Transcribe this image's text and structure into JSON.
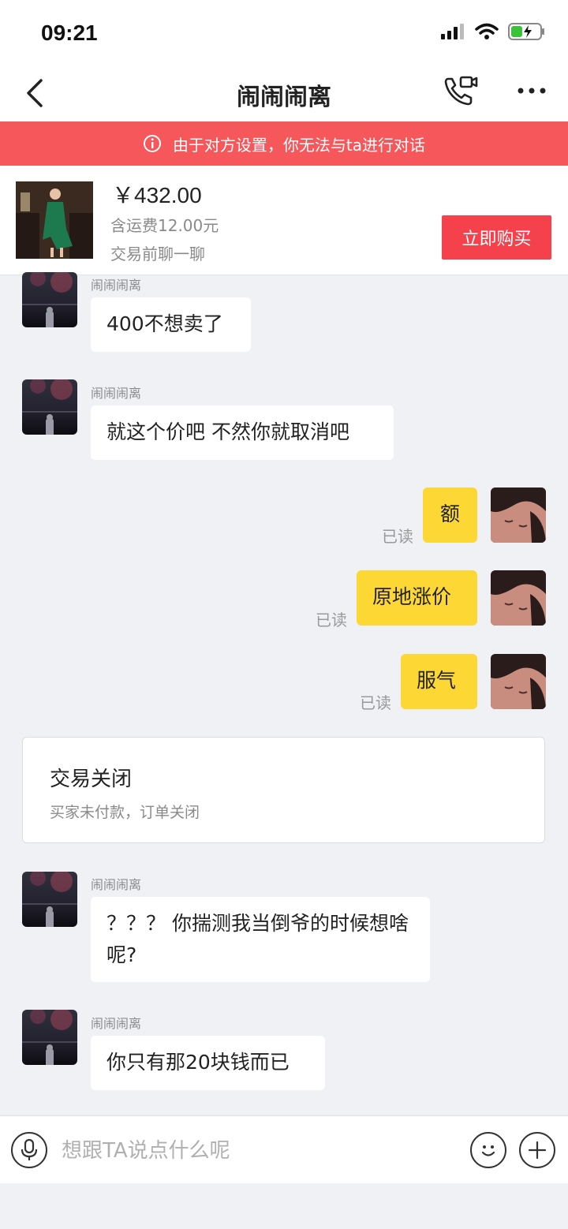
{
  "status_bar": {
    "time": "09:21",
    "icons": [
      "signal-icon",
      "wifi-icon",
      "battery-icon"
    ],
    "battery_color": "#3cc13b"
  },
  "nav": {
    "title": "闹闹闹离",
    "icons": [
      "back-icon",
      "phone-video-icon",
      "more-icon"
    ]
  },
  "banner": {
    "text": "由于对方设置，你无法与ta进行对话",
    "icon": "info-icon",
    "color": "#f5575a"
  },
  "product": {
    "price": "￥432.00",
    "shipping": "含运费12.00元",
    "chat_label": "交易前聊一聊",
    "buy_label": "立即购买",
    "buy_color": "#f5414b"
  },
  "messages": [
    {
      "from": "other",
      "name": "闹闹闹离",
      "text": "400不想卖了"
    },
    {
      "from": "other",
      "name": "闹闹闹离",
      "text": "就这个价吧 不然你就取消吧"
    },
    {
      "from": "self",
      "read": "已读",
      "text": "额"
    },
    {
      "from": "self",
      "read": "已读",
      "text": "原地涨价"
    },
    {
      "from": "self",
      "read": "已读",
      "text": "服气"
    },
    {
      "from": "other",
      "name": "闹闹闹离",
      "text": "？？？ 你揣测我当倒爷的时候想啥呢?"
    },
    {
      "from": "other",
      "name": "闹闹闹离",
      "text": "你只有那20块钱而已"
    }
  ],
  "trade_status": {
    "title": "交易关闭",
    "subtitle": "买家未付款，订单关闭"
  },
  "input_bar": {
    "placeholder": "想跟TA说点什么呢",
    "icons": [
      "microphone-icon",
      "emoji-icon",
      "plus-icon"
    ]
  },
  "colors": {
    "outgoing_bubble": "#fdd834",
    "incoming_bubble": "#ffffff",
    "background": "#f0f1f5"
  }
}
